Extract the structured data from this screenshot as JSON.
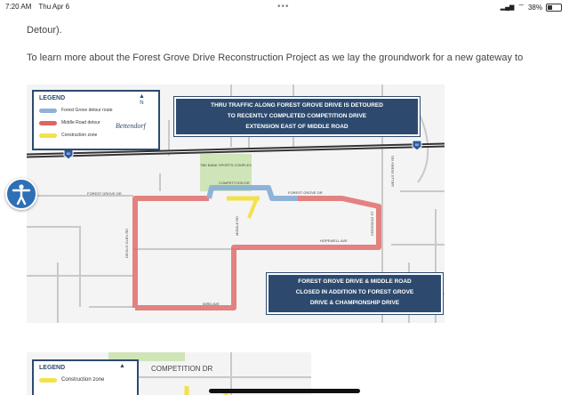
{
  "status_bar": {
    "time": "7:20 AM",
    "date": "Thu Apr 6",
    "battery_percent": "38%",
    "battery_level": 0.38
  },
  "content": {
    "paragraph_1": "Detour).",
    "paragraph_2": "To learn more about the Forest Grove Drive Reconstruction Project as we lay the groundwork for a new gateway to"
  },
  "map": {
    "legend_title": "LEGEND",
    "legend_items": [
      {
        "label": "Forest Grove detour route",
        "color": "#8fb3d6"
      },
      {
        "label": "Middle Road detour",
        "color": "#e06464"
      },
      {
        "label": "Construction zone",
        "color": "#f2e24a"
      }
    ],
    "brand": "Bettendorf",
    "north_label": "N",
    "callout_top": [
      "THRU TRAFFIC ALONG FOREST GROVE DRIVE IS DETOURED",
      "TO RECENTLY COMPLETED COMPETITION DRIVE",
      "EXTENSION EAST OF MIDDLE ROAD"
    ],
    "callout_bottom": [
      "FOREST GROVE DRIVE & MIDDLE ROAD",
      "CLOSED IN ADDITION TO FOREST GROVE",
      "DRIVE & CHAMPIONSHIP DRIVE"
    ],
    "interstate_label": "80",
    "road_labels": {
      "forest_grove_west": "FOREST GROVE DR",
      "forest_grove_east": "FOREST GROVE DR",
      "competition": "COMPETITION DR",
      "hopewell": "HOPEWELL AVE",
      "devils_glen": "DEVILS GLEN RD",
      "middle": "MIDDLE RD",
      "street_53rd": "53RD AVE",
      "wells_ferry": "WELLS FERRY RD",
      "crossing": "CROSSING ST",
      "park": "TBK BANK SPORTS COMPLEX"
    }
  },
  "map2": {
    "legend_title": "LEGEND",
    "legend_item": "Construction zone",
    "north_label": "N",
    "road_label": "COMPETITION DR"
  }
}
